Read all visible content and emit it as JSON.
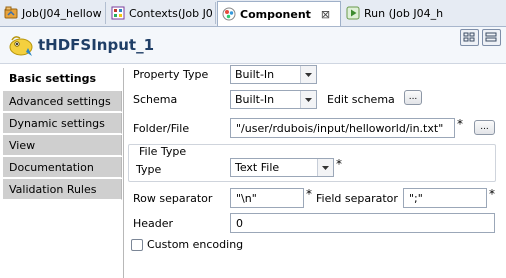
{
  "tabs": [
    {
      "label": "Job(J04_hellow",
      "icon": "job-icon"
    },
    {
      "label": "Contexts(Job J0",
      "icon": "contexts-icon"
    },
    {
      "label": "Component",
      "icon": "component-icon",
      "close": "⊠",
      "active": true
    },
    {
      "label": "Run (Job J04_h",
      "icon": "run-icon"
    }
  ],
  "header": {
    "title": "tHDFSInput_1"
  },
  "sidebar": {
    "items": [
      {
        "label": "Basic settings",
        "active": true
      },
      {
        "label": "Advanced settings"
      },
      {
        "label": "Dynamic settings"
      },
      {
        "label": "View"
      },
      {
        "label": "Documentation"
      },
      {
        "label": "Validation Rules"
      }
    ]
  },
  "form": {
    "property_type_label": "Property Type",
    "property_type_value": "Built-In",
    "schema_label": "Schema",
    "schema_value": "Built-In",
    "edit_schema_label": "Edit schema",
    "folder_label": "Folder/File",
    "folder_value": "\"/user/rdubois/input/helloworld/in.txt\"",
    "file_type_group_label": "File Type",
    "type_label": "Type",
    "type_value": "Text File",
    "row_sep_label": "Row separator",
    "row_sep_value": "\"\\n\"",
    "field_sep_label": "Field separator",
    "field_sep_value": "\";\"",
    "header_label": "Header",
    "header_value": "0",
    "custom_encoding_label": "Custom encoding",
    "custom_encoding_checked": false,
    "required_mark": "*",
    "browse_label": "..."
  },
  "colors": {
    "accent": "#1f3e66",
    "tab_bar_bg": "#e6ebf3",
    "sidebar_bg": "#cfcfcf"
  }
}
